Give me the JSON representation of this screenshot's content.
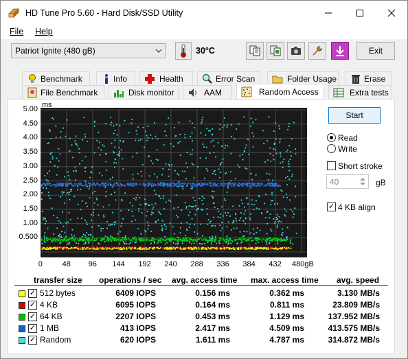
{
  "window": {
    "title": "HD Tune Pro 5.60 - Hard Disk/SSD Utility"
  },
  "menu": {
    "file": "File",
    "help": "Help"
  },
  "drive": {
    "selected": "Patriot Ignite (480 gB)"
  },
  "temperature": "30°C",
  "exit_label": "Exit",
  "tabs_row1": [
    "Benchmark",
    "Info",
    "Health",
    "Error Scan",
    "Folder Usage",
    "Erase"
  ],
  "tabs_row2": [
    "File Benchmark",
    "Disk monitor",
    "AAM",
    "Random Access",
    "Extra tests"
  ],
  "active_tab": "Random Access",
  "chart_data": {
    "type": "scatter",
    "ylabel": "ms",
    "y_ticks": [
      "5.00",
      "4.50",
      "4.00",
      "3.50",
      "3.00",
      "2.50",
      "2.00",
      "1.50",
      "1.00",
      "0.500"
    ],
    "x_ticks": [
      "0",
      "48",
      "96",
      "144",
      "192",
      "240",
      "288",
      "336",
      "384",
      "432",
      "480gB"
    ],
    "ylim": [
      0,
      5
    ],
    "xlim": [
      0,
      480
    ],
    "grid": true,
    "series": [
      {
        "name": "512 bytes",
        "color": "#e8e800",
        "avg_ms": 0.156,
        "max_ms": 0.362
      },
      {
        "name": "4 KB",
        "color": "#e00000",
        "avg_ms": 0.164,
        "max_ms": 0.811
      },
      {
        "name": "64 KB",
        "color": "#00d000",
        "avg_ms": 0.453,
        "max_ms": 1.129
      },
      {
        "name": "1 MB",
        "color": "#2a6fe0",
        "avg_ms": 2.417,
        "max_ms": 4.509
      },
      {
        "name": "Random",
        "color": "#40e0e0",
        "avg_ms": 1.611,
        "max_ms": 4.787
      }
    ]
  },
  "controls": {
    "start": "Start",
    "read": "Read",
    "write": "Write",
    "short_stroke": "Short stroke",
    "stroke_value": "40",
    "stroke_unit": "gB",
    "align": "4 KB align"
  },
  "table": {
    "headers": [
      "transfer size",
      "operations / sec",
      "avg. access time",
      "max. access time",
      "avg. speed"
    ],
    "rows": [
      {
        "size": "512 bytes",
        "ops": "6409 IOPS",
        "avg": "0.156 ms",
        "max": "0.362 ms",
        "speed": "3.130 MB/s",
        "color": "#ffff00"
      },
      {
        "size": "4 KB",
        "ops": "6095 IOPS",
        "avg": "0.164 ms",
        "max": "0.811 ms",
        "speed": "23.809 MB/s",
        "color": "#e00000"
      },
      {
        "size": "64 KB",
        "ops": "2207 IOPS",
        "avg": "0.453 ms",
        "max": "1.129 ms",
        "speed": "137.952 MB/s",
        "color": "#00c000"
      },
      {
        "size": "1 MB",
        "ops": "413 IOPS",
        "avg": "2.417 ms",
        "max": "4.509 ms",
        "speed": "413.575 MB/s",
        "color": "#1060e0"
      },
      {
        "size": "Random",
        "ops": "620 IOPS",
        "avg": "1.611 ms",
        "max": "4.787 ms",
        "speed": "314.872 MB/s",
        "color": "#40e0e0"
      }
    ]
  }
}
